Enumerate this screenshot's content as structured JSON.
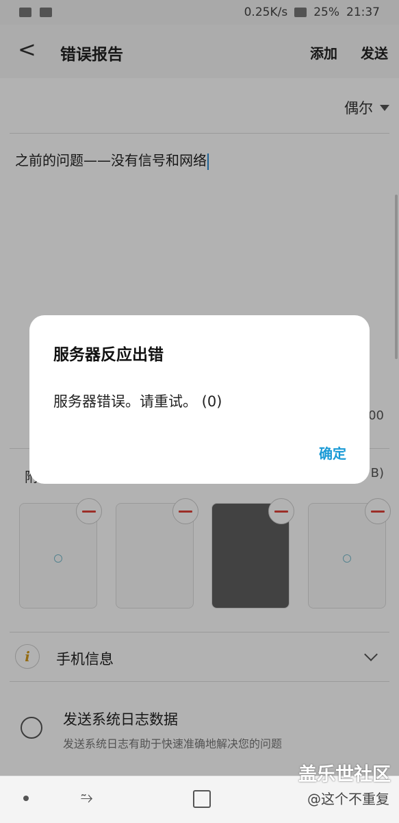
{
  "status_bar": {
    "speed": "0.25K/s",
    "battery": "25%",
    "time": "21:37"
  },
  "appbar": {
    "back_label": "<",
    "title": "错误报告",
    "add_label": "添加",
    "send_label": "发送"
  },
  "form": {
    "category": "偶尔",
    "description": "之前的问题——没有信号和网络",
    "counter_partial": "00",
    "attachments_label_partial": "附",
    "attachments_size_partial": "B)"
  },
  "phone_info_label": "手机信息",
  "system_log": {
    "title": "发送系统日志数据",
    "description": "发送系统日志有助于快速准确地解决您的问题"
  },
  "dialog": {
    "title": "服务器反应出错",
    "message": "服务器错误。请重试。 (0)",
    "ok_label": "确定"
  },
  "watermark": {
    "brand": "盖乐世社区",
    "user": "@这个不重复"
  },
  "icons": [
    "back-arrow-icon",
    "dropdown-triangle-icon",
    "info-icon",
    "chevron-down-icon",
    "remove-icon",
    "radio-icon",
    "recent-apps-icon",
    "home-icon",
    "back-nav-icon"
  ],
  "colors": {
    "accent": "#1a9ad6",
    "remove_red": "#e0433a",
    "info_gold": "#d59a1a"
  }
}
